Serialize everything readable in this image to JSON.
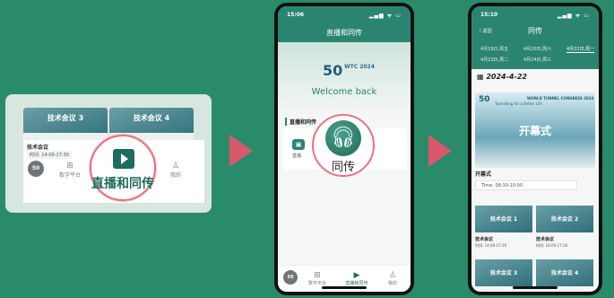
{
  "panel1": {
    "cards": [
      "技术会议 3",
      "技术会议 4"
    ],
    "meeting_title": "技术会议",
    "meeting_time": "时间: 14:00-17:30",
    "nav": {
      "logo": "50",
      "digital": "数字平台",
      "live": "直播和同传",
      "me": "我的"
    },
    "zoom_label": "直播和同传"
  },
  "phone2": {
    "status_time": "15:06",
    "status_icons": "▂▄▆ ᯤ ▭",
    "title": "直播和同传",
    "logo_big": "50",
    "logo_small": "WTC 2024",
    "welcome": "Welcome back",
    "section": "直播和同传",
    "live_item": "直播",
    "translate_label": "同传",
    "nav": {
      "logo": "50",
      "digital": "数字平台",
      "live": "直播和同传",
      "me": "我的"
    }
  },
  "phone3": {
    "status_time": "15:10",
    "status_icons": "▂▄▆ ᯤ ▭",
    "back": "〈 返回",
    "title": "同传",
    "dates": [
      "4月19日,周五",
      "4月20日,周六",
      "4月22日,周一",
      "4月23日,周二",
      "4月24日,周三"
    ],
    "selected_date": "2024-4-22",
    "banner_title": "WORLD TUNNEL CONGRESS 2024",
    "banner_sub": "Tunnelling for a Better Life",
    "opening": "开幕式",
    "opening_label": "开幕式",
    "opening_time": "Time: 08:30-10:00",
    "grid": [
      {
        "card": "技术会议 1",
        "title": "技术会议",
        "time": "时间: 14:00-17:30"
      },
      {
        "card": "技术会议 2",
        "title": "技术会议",
        "time": "时间: 14:00-17:30"
      },
      {
        "card": "技术会议 3",
        "title": "",
        "time": ""
      },
      {
        "card": "技术会议 4",
        "title": "",
        "time": ""
      }
    ]
  }
}
